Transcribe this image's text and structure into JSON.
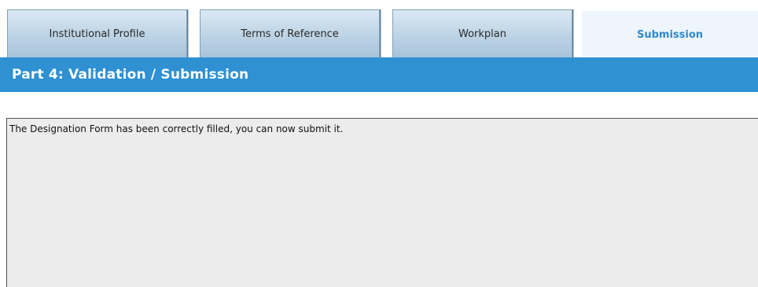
{
  "tabs": [
    {
      "label": "Institutional Profile"
    },
    {
      "label": "Terms of Reference"
    },
    {
      "label": "Workplan"
    },
    {
      "label": "Submission",
      "active": true
    }
  ],
  "section": {
    "title": "Part 4: Validation / Submission"
  },
  "message": {
    "text": "The Designation Form has been correctly filled, you can now submit it."
  },
  "colors": {
    "header_bg": "#2f90d2",
    "active_tab_text": "#2f8ad0",
    "active_tab_bg": "#eef5fc",
    "message_bg": "#ececec"
  }
}
